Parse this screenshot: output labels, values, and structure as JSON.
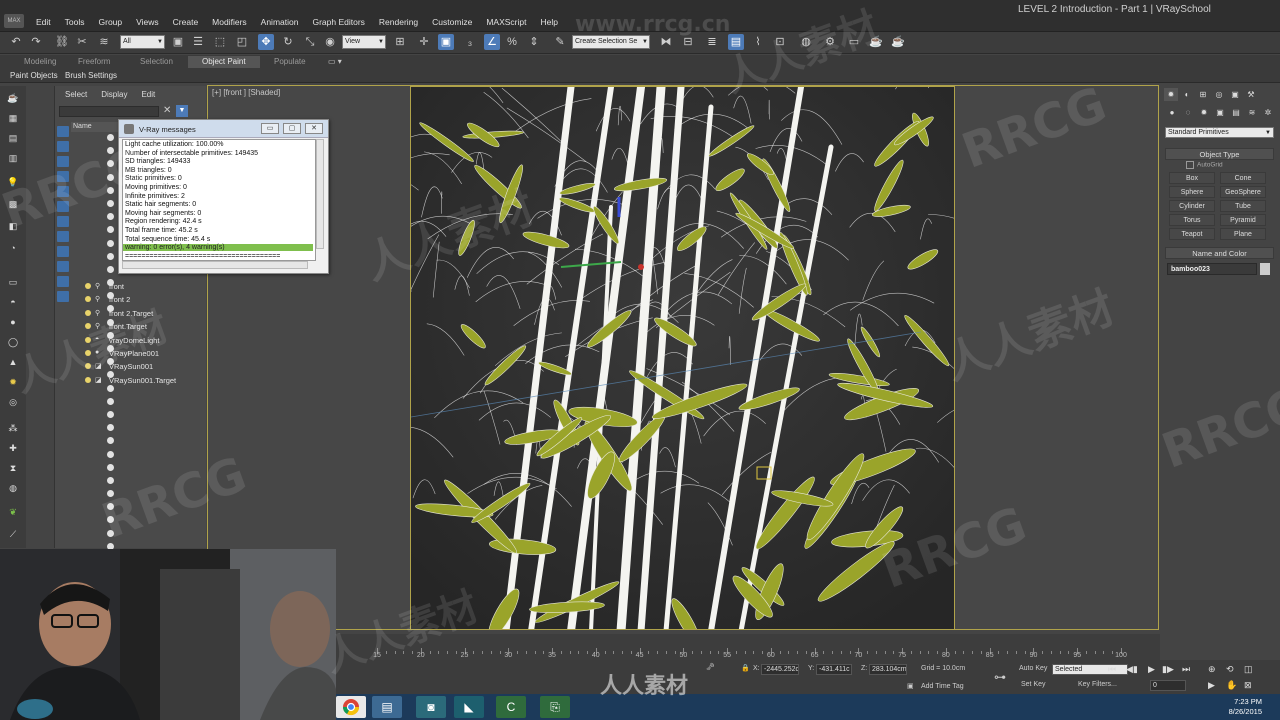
{
  "app": {
    "title": "LEVEL 2 Introduction - Part 1 | VRaySchool",
    "logo": "MAX"
  },
  "menu": [
    "Edit",
    "Tools",
    "Group",
    "Views",
    "Create",
    "Modifiers",
    "Animation",
    "Graph Editors",
    "Rendering",
    "Customize",
    "MAXScript",
    "Help"
  ],
  "toolbar": {
    "filter_value": "All",
    "refcoord_value": "View",
    "selection_set_value": "Create Selection Se"
  },
  "ribbon": {
    "tabs": [
      "Modeling",
      "Freeform",
      "Selection",
      "Object Paint",
      "Populate"
    ],
    "selected": "Object Paint",
    "subtabs": [
      "Paint Objects",
      "Brush Settings"
    ]
  },
  "explorer": {
    "menu": [
      "Select",
      "Display",
      "Edit"
    ],
    "column_header": "Name",
    "rows": [
      "front",
      "front 2",
      "front 2.Target",
      "front.Target",
      "vrayDomeLight",
      "VRayPlane001",
      "VRaySun001",
      "VRaySun001.Target"
    ]
  },
  "vray_messages": {
    "title": "V-Ray messages",
    "lines": [
      "Light cache utilization: 100.00%",
      "Number of intersectable primitives: 149435",
      "  SD triangles: 149433",
      "  MB triangles: 0",
      "  Static primitives: 0",
      "  Moving primitives: 0",
      "  Infinite primitives: 2",
      "  Static hair segments: 0",
      "  Moving hair segments: 0",
      "Region rendering: 42.4 s",
      "Total frame time: 45.2 s",
      "Total sequence time: 45.4 s"
    ],
    "warning": "warning: 0 error(s), 4 warning(s)",
    "divider": "======================================"
  },
  "viewport": {
    "label": "[+] [front ] [Shaded]"
  },
  "command_panel": {
    "dropdown": "Standard Primitives",
    "object_type_title": "Object Type",
    "autogrid": "AutoGrid",
    "buttons": [
      "Box",
      "Cone",
      "Sphere",
      "GeoSphere",
      "Cylinder",
      "Tube",
      "Torus",
      "Pyramid",
      "Teapot",
      "Plane"
    ],
    "name_color_title": "Name and Color",
    "object_name": "bamboo023"
  },
  "timeline": {
    "ticks": [
      15,
      20,
      25,
      30,
      35,
      40,
      45,
      50,
      55,
      60,
      65,
      70,
      75,
      80,
      85,
      90,
      95,
      100
    ]
  },
  "status": {
    "x_label": "X:",
    "x_value": "-2445.252c",
    "y_label": "Y:",
    "y_value": "-431.411c",
    "z_label": "Z:",
    "z_value": "283.104cm",
    "grid": "Grid = 10.0cm",
    "add_time_tag": "Add Time Tag",
    "auto_key": "Auto Key",
    "set_key": "Set Key",
    "key_mode": "Selected",
    "key_filters": "Key Filters...",
    "frame": "0"
  },
  "taskbar": {
    "time": "7:23 PM",
    "date": "8/26/2015"
  },
  "watermarks": [
    "www.rrcg.cn",
    "RRCG",
    "人人素材"
  ],
  "colors": {
    "accent": "#4d7bb8",
    "viewport_border": "#b0a34a",
    "warning_bg": "#7fbf4d",
    "leaf": "#9aa42a"
  }
}
